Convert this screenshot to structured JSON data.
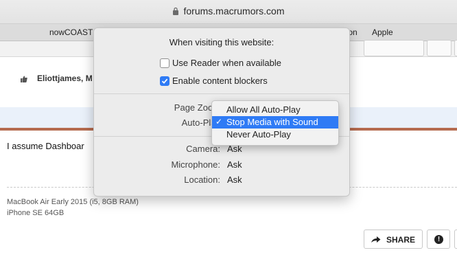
{
  "browser": {
    "url": "forums.macrumors.com",
    "favorites": [
      "nowCOAST",
      "ton",
      "Apple"
    ]
  },
  "post": {
    "author": "Eliottjames, M",
    "body_text": "I assume Dashboar",
    "signature": [
      "MacBook Air Early 2015 (i5, 8GB RAM)",
      "iPhone SE 64GB"
    ],
    "share_label": "SHARE",
    "report_glyph": "!"
  },
  "popover": {
    "title": "When visiting this website:",
    "reader_label": "Use Reader when available",
    "reader_checked": false,
    "blockers_label": "Enable content blockers",
    "blockers_checked": true,
    "page_zoom_label": "Page Zoom",
    "autoplay_label": "Auto-Play",
    "camera_label": "Camera:",
    "camera_value": "Ask",
    "microphone_label": "Microphone:",
    "microphone_value": "Ask",
    "location_label": "Location:",
    "location_value": "Ask"
  },
  "autoplay_menu": {
    "options": [
      "Allow All Auto-Play",
      "Stop Media with Sound",
      "Never Auto-Play"
    ],
    "selected": "Stop Media with Sound",
    "checkmark": "✓"
  },
  "colors": {
    "accent": "#2f7bf5",
    "divider": "#b56b4f",
    "highlight_band": "#eaf1fa"
  }
}
